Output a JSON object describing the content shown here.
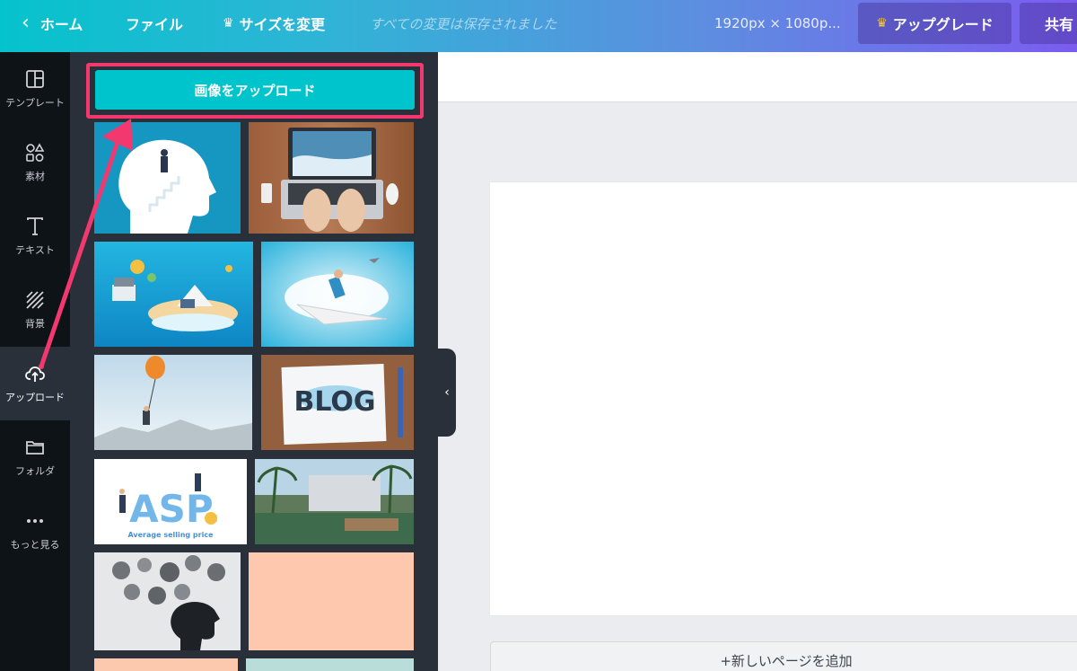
{
  "topbar": {
    "home_label": "ホーム",
    "file_label": "ファイル",
    "resize_label": "サイズを変更",
    "saved_status": "すべての変更は保存されました",
    "dimensions": "1920px × 1080p...",
    "upgrade_label": "アップグレード",
    "share_label": "共有"
  },
  "sidebar": {
    "items": [
      {
        "label": "テンプレート",
        "icon": "template-icon"
      },
      {
        "label": "素材",
        "icon": "elements-icon"
      },
      {
        "label": "テキスト",
        "icon": "text-icon"
      },
      {
        "label": "背景",
        "icon": "background-icon"
      },
      {
        "label": "アップロード",
        "icon": "upload-cloud-icon",
        "active": true
      },
      {
        "label": "フォルダ",
        "icon": "folder-icon"
      },
      {
        "label": "もっと見る",
        "icon": "more-dots-icon"
      }
    ]
  },
  "panel": {
    "upload_button_label": "画像をアップロード",
    "thumbnails": [
      {
        "alt": "head silhouette with stairs"
      },
      {
        "alt": "hands typing on laptop"
      },
      {
        "alt": "isometric island illustration"
      },
      {
        "alt": "man on paper plane"
      },
      {
        "alt": "man hanging from balloon"
      },
      {
        "alt": "BLOG notepad",
        "text": "BLOG"
      },
      {
        "alt": "ASP illustration",
        "text": "ASP.",
        "caption": "Average selling price"
      },
      {
        "alt": "palm trees building"
      },
      {
        "alt": "crumpled paper head"
      },
      {
        "alt": "peach color block"
      }
    ]
  },
  "canvas": {
    "add_page_label": "+新しいページを追加"
  },
  "colors": {
    "accent": "#00c4cc",
    "highlight": "#f2386f",
    "rail_bg": "#0e1318",
    "panel_bg": "#293039"
  }
}
